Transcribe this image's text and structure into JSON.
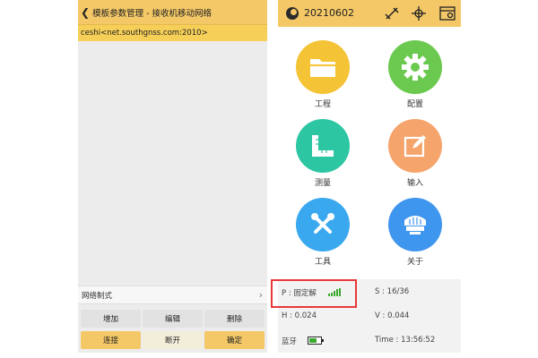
{
  "left_screen": {
    "header_title": "模板参数管理 - 接收机移动网络",
    "selected_item": "ceshi<net.southgnss.com:2010>",
    "network_mode_label": "网络制式",
    "buttons_row1": [
      "增加",
      "编辑",
      "删除"
    ],
    "buttons_row2": [
      "连接",
      "断开",
      "确定"
    ]
  },
  "right_screen": {
    "title": "20210602",
    "menu": [
      {
        "label": "工程",
        "icon": "folder-icon",
        "color": "#f5c336"
      },
      {
        "label": "配置",
        "icon": "gear-icon",
        "color": "#6bc94f"
      },
      {
        "label": "测量",
        "icon": "ruler-icon",
        "color": "#2dc6a3"
      },
      {
        "label": "输入",
        "icon": "edit-icon",
        "color": "#f5a46b"
      },
      {
        "label": "工具",
        "icon": "tools-icon",
        "color": "#3aa8ef"
      },
      {
        "label": "关于",
        "icon": "receiver-icon",
        "color": "#3f96ee"
      }
    ],
    "status": {
      "position": "P : 固定解",
      "satellites": "S : 16/36",
      "h": "H : 0.024",
      "v": "V : 0.044",
      "bluetooth": "蓝牙",
      "time": "Time :  13:56:52"
    },
    "colors": {
      "accent": "#f4c867",
      "highlight_box": "#e8393a"
    }
  }
}
